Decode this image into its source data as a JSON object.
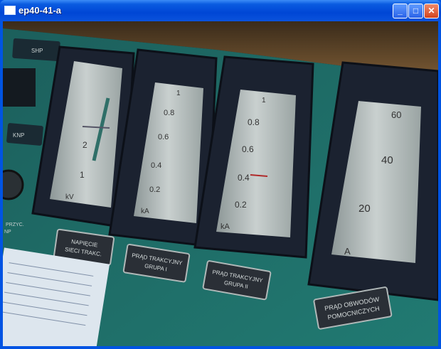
{
  "window": {
    "title": "ep40-41-a",
    "minimize_glyph": "_",
    "maximize_glyph": "□",
    "close_glyph": "✕"
  },
  "panel": {
    "small_labels": [
      "SHP",
      "KNP",
      "PRZYC.",
      "NP"
    ],
    "gauges": [
      {
        "ticks": [
          "2",
          "1"
        ],
        "unit": "kV"
      },
      {
        "ticks": [
          "1",
          "0.8",
          "0.6",
          "0.4",
          "0.2"
        ],
        "unit": "kA"
      },
      {
        "ticks": [
          "1",
          "0.8",
          "0.6",
          "0.4",
          "0.2"
        ],
        "unit": "kA"
      },
      {
        "ticks": [
          "60",
          "40",
          "20"
        ],
        "unit": "A"
      }
    ],
    "plates": [
      {
        "line1": "NAPIĘCIE",
        "line2": "SIECI TRAKC."
      },
      {
        "line1": "PRĄD TRAKCYJNY",
        "line2": "GRUPA I"
      },
      {
        "line1": "PRĄD TRAKCYJNY",
        "line2": "GRUPA II"
      },
      {
        "line1": "PRĄD OBWODÓW",
        "line2": "POMOCNICZYCH"
      }
    ]
  },
  "colors": {
    "panel": "#1f6e6a",
    "gauge_frame": "#1a2130",
    "gauge_face": "#b8c0c0",
    "titlebar": "#0054e3"
  }
}
